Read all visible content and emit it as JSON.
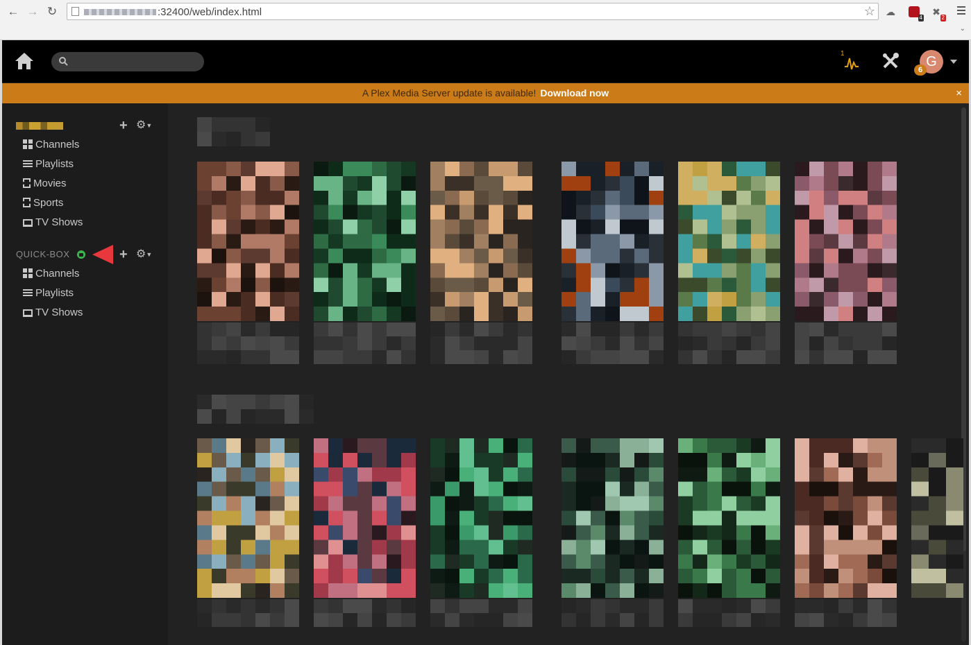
{
  "browser": {
    "url": ":32400/web/index.html",
    "extensions": [
      {
        "name": "ublock-icon",
        "badge": "4",
        "badge_color": "#333333"
      },
      {
        "name": "extension-icon",
        "badge": "2",
        "badge_color": "#cc2222"
      }
    ]
  },
  "header": {
    "search_placeholder": "",
    "activity_count": "1",
    "avatar_letter": "G",
    "avatar_badge": "6"
  },
  "banner": {
    "message": "A Plex Media Server update is available!",
    "link": "Download now",
    "close": "×",
    "color": "#cc7b19"
  },
  "sidebar": {
    "server1": {
      "items": [
        {
          "label": "Channels",
          "icon": "grid-icon"
        },
        {
          "label": "Playlists",
          "icon": "list-icon"
        },
        {
          "label": "Movies",
          "icon": "film-icon"
        },
        {
          "label": "Sports",
          "icon": "film-icon"
        },
        {
          "label": "TV Shows",
          "icon": "tv-icon"
        }
      ]
    },
    "server2": {
      "name": "QUICK-BOX",
      "items": [
        {
          "label": "Channels",
          "icon": "grid-icon"
        },
        {
          "label": "Playlists",
          "icon": "list-icon"
        },
        {
          "label": "TV Shows",
          "icon": "tv-icon"
        }
      ]
    },
    "accent_green": "#3fb34f",
    "arrow_red": "#e8383d"
  }
}
